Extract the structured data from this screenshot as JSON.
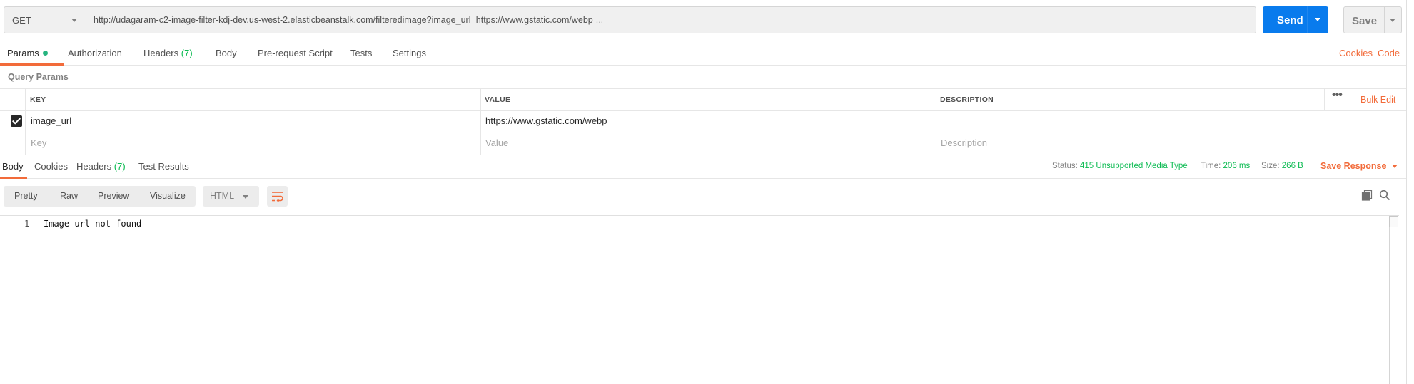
{
  "request": {
    "method": "GET",
    "url": "http://udagaram-c2-image-filter-kdj-dev.us-west-2.elasticbeanstalk.com/filteredimage?image_url=https://www.gstatic.com/webp",
    "url_overflow": "...",
    "send_label": "Send",
    "save_label": "Save"
  },
  "request_tabs": [
    {
      "label": "Params",
      "active": true
    },
    {
      "label": "Authorization"
    },
    {
      "label": "Headers",
      "count": "(7)"
    },
    {
      "label": "Body"
    },
    {
      "label": "Pre-request Script"
    },
    {
      "label": "Tests"
    },
    {
      "label": "Settings"
    }
  ],
  "links": {
    "cookies": "Cookies",
    "code": "Code"
  },
  "query_params": {
    "title": "Query Params",
    "columns": [
      "KEY",
      "VALUE",
      "DESCRIPTION"
    ],
    "bulk_edit": "Bulk Edit",
    "rows": [
      {
        "checked": true,
        "key": "image_url",
        "value": "https://www.gstatic.com/webp",
        "description": ""
      }
    ],
    "placeholders": {
      "key": "Key",
      "value": "Value",
      "description": "Description"
    }
  },
  "response_tabs": [
    {
      "label": "Body",
      "active": true
    },
    {
      "label": "Cookies"
    },
    {
      "label": "Headers",
      "count": "(7)"
    },
    {
      "label": "Test Results"
    }
  ],
  "response_meta": {
    "status_label": "Status:",
    "status_value": "415 Unsupported Media Type",
    "time_label": "Time:",
    "time_value": "206 ms",
    "size_label": "Size:",
    "size_value": "266 B",
    "save_response": "Save Response"
  },
  "view_modes": [
    "Pretty",
    "Raw",
    "Preview",
    "Visualize"
  ],
  "format": "HTML",
  "body": {
    "lines": [
      {
        "num": "1",
        "text": "Image url not found"
      }
    ]
  },
  "colors": {
    "accent": "#f26b3a",
    "send": "#097bed",
    "success": "#0cbb52"
  }
}
